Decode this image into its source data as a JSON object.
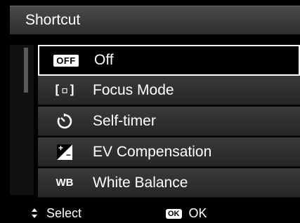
{
  "header": {
    "title": "Shortcut"
  },
  "menu": {
    "items": [
      {
        "icon": "off-icon",
        "badge": "OFF",
        "label": "Off",
        "selected": true
      },
      {
        "icon": "focus-mode-icon",
        "glyph": "[▫]",
        "label": "Focus Mode"
      },
      {
        "icon": "self-timer-icon",
        "glyph": "⏲",
        "label": "Self-timer"
      },
      {
        "icon": "ev-compensation-icon",
        "label": "EV Compensation"
      },
      {
        "icon": "white-balance-icon",
        "glyph": "WB",
        "label": "White Balance"
      }
    ]
  },
  "footer": {
    "select_icon": "up-down-arrows-icon",
    "select_label": "Select",
    "ok_badge": "OK",
    "ok_label": "OK"
  }
}
